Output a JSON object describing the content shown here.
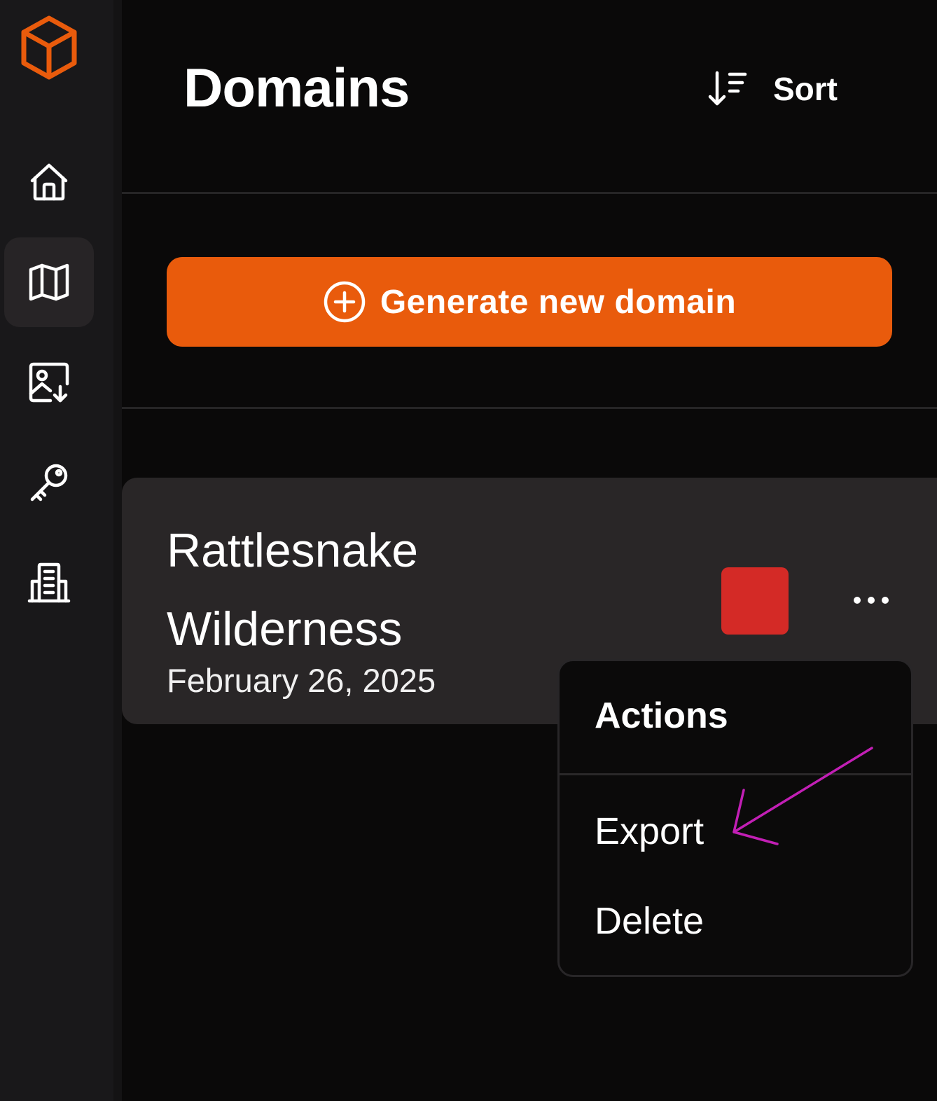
{
  "header": {
    "title": "Domains",
    "sort_label": "Sort"
  },
  "sidebar": {
    "items": [
      {
        "name": "home",
        "icon": "home-icon",
        "active": false
      },
      {
        "name": "map",
        "icon": "map-icon",
        "active": true
      },
      {
        "name": "image-download",
        "icon": "image-download-icon",
        "active": false
      },
      {
        "name": "keys",
        "icon": "key-icon",
        "active": false
      },
      {
        "name": "documents",
        "icon": "building-document-icon",
        "active": false
      }
    ]
  },
  "generate_button": {
    "label": "Generate new domain",
    "icon": "plus-circle-icon"
  },
  "domain": {
    "name": "Rattlesnake Wilderness",
    "date": "February 26, 2025",
    "color": "#d42a26"
  },
  "actions_menu": {
    "title": "Actions",
    "items": [
      {
        "label": "Export"
      },
      {
        "label": "Delete"
      }
    ]
  },
  "colors": {
    "accent": "#e95b0c",
    "background": "#0a0909",
    "sidebar": "#19181a",
    "card": "#292627",
    "annotation": "#c21fb5"
  }
}
